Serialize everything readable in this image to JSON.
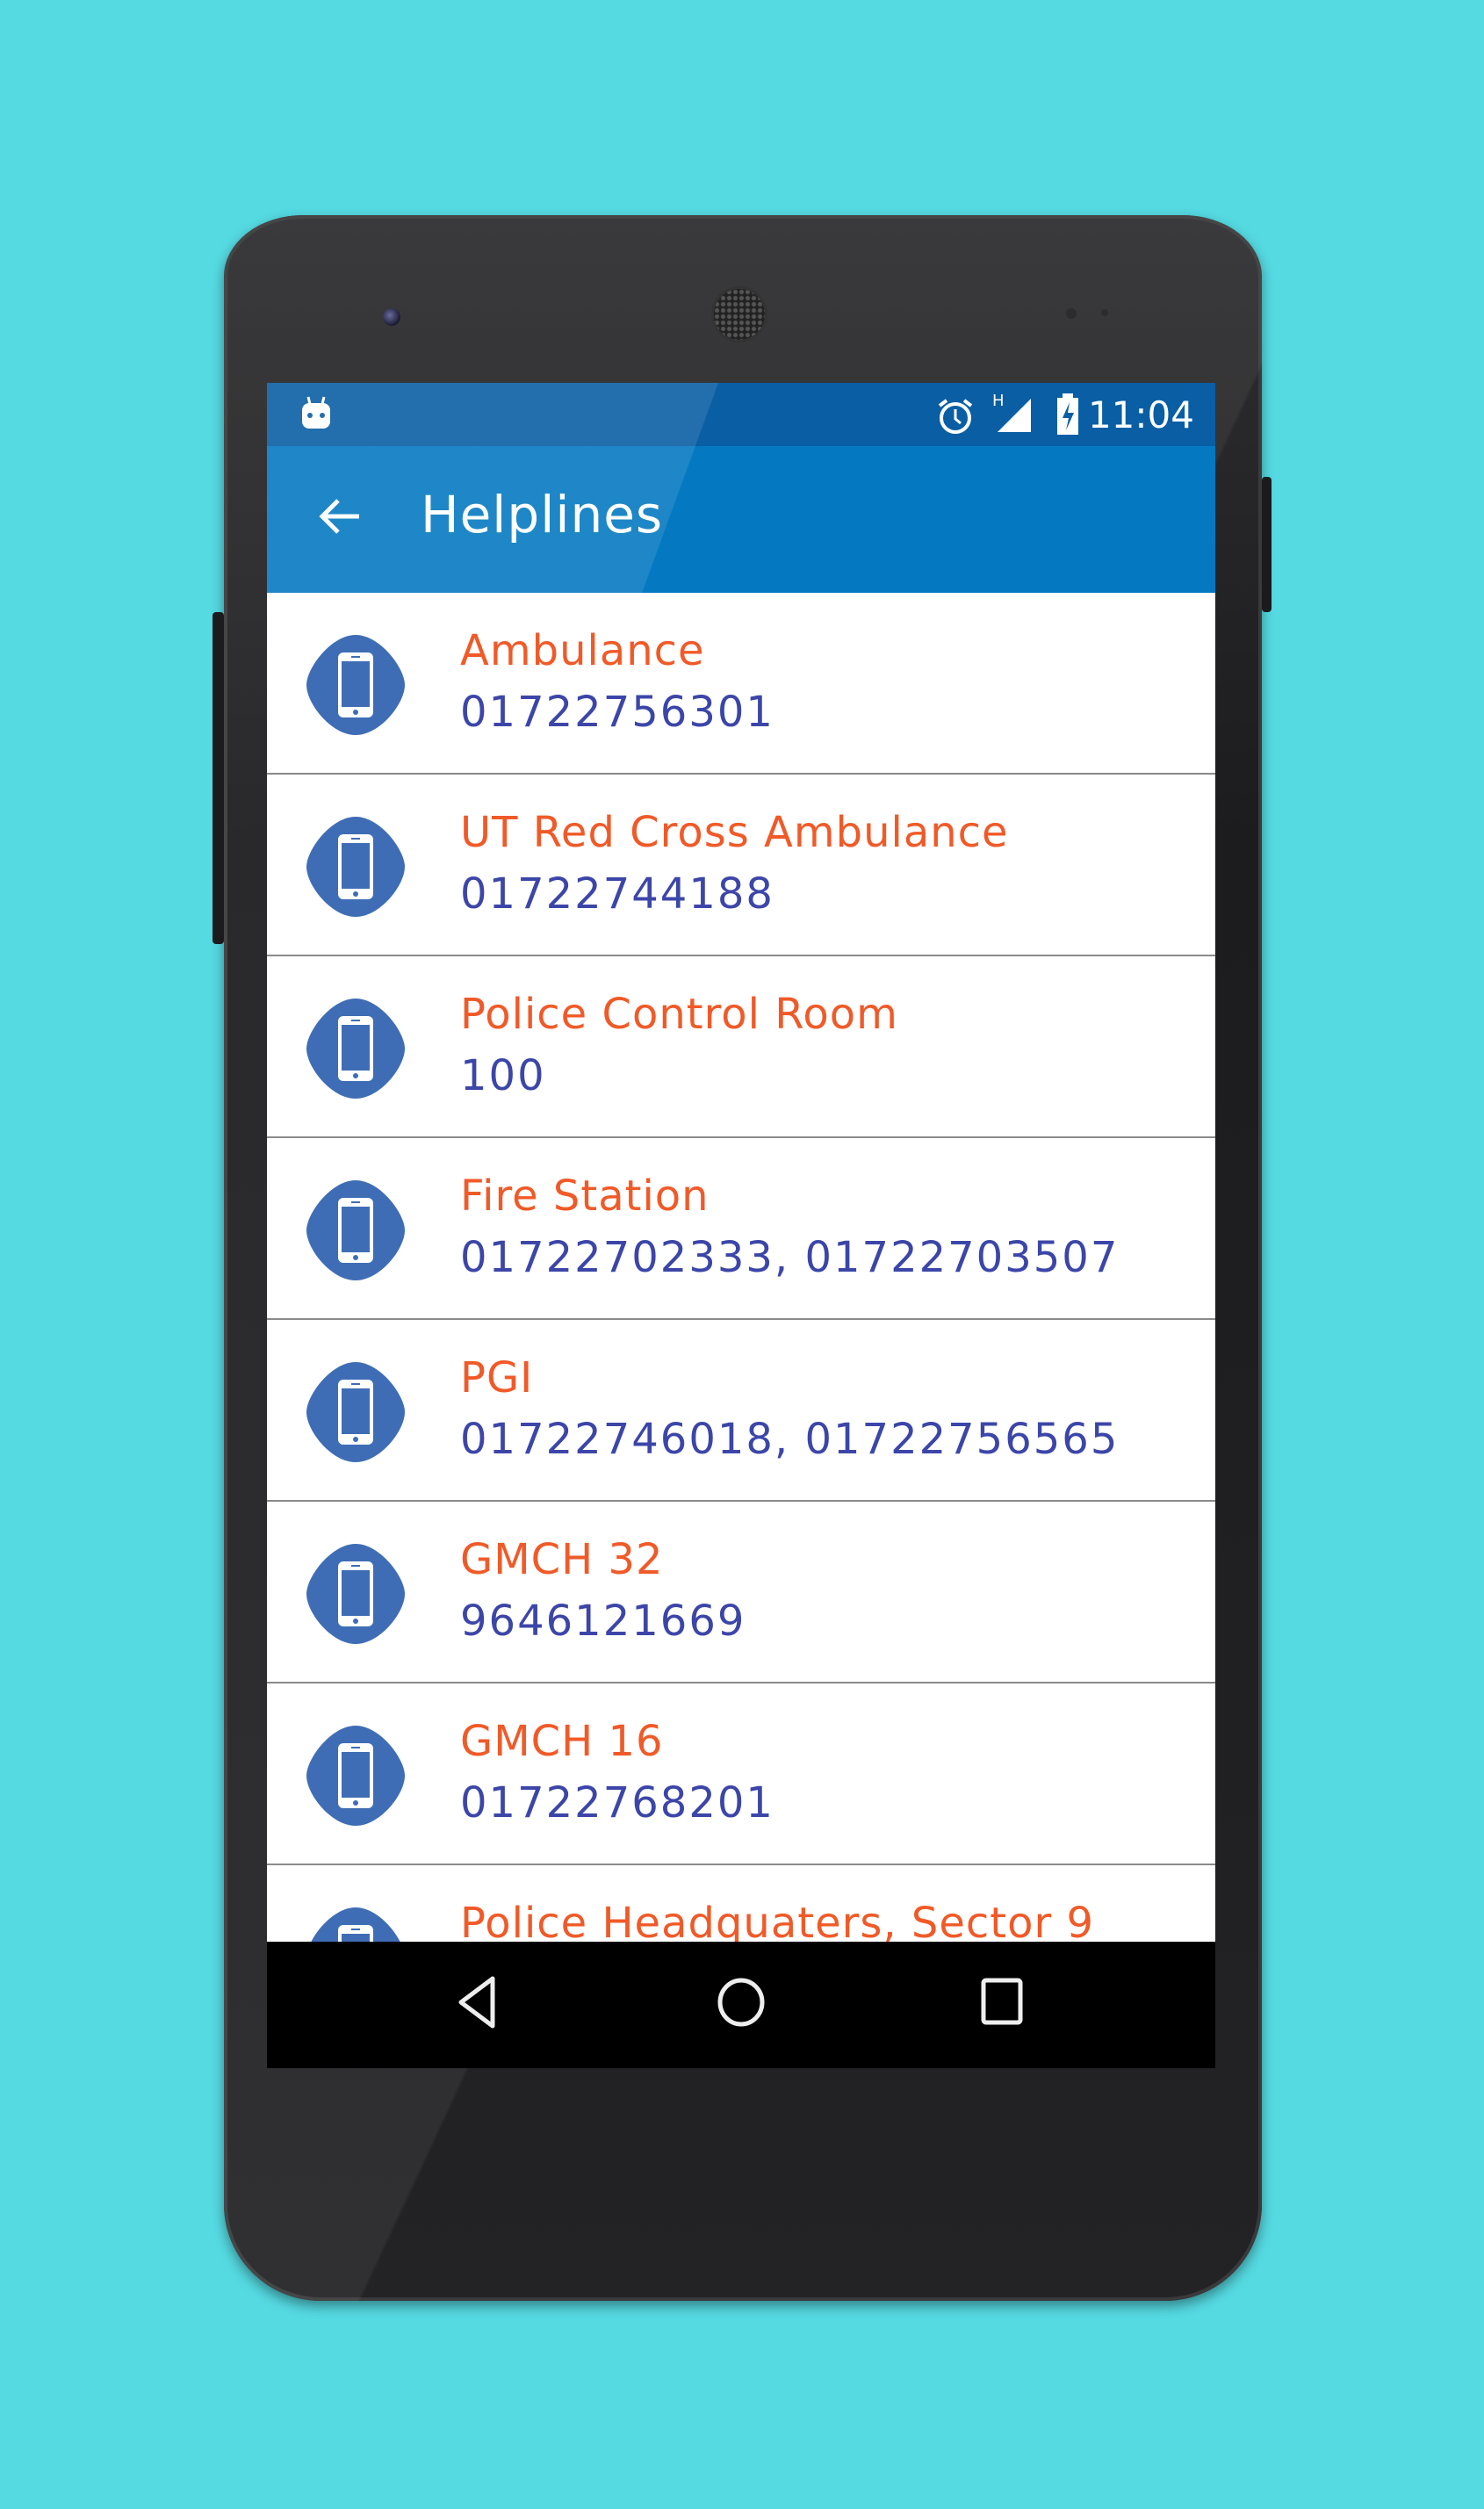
{
  "status_bar": {
    "time": "11:04",
    "network_label": "H",
    "icons": [
      "android-icon",
      "alarm-icon",
      "signal-icon",
      "battery-charging-icon"
    ]
  },
  "app_bar": {
    "title": "Helplines",
    "back_icon": "arrow-left-icon"
  },
  "colors": {
    "background": "#55dae2",
    "app_bar": "#0479c1",
    "status_bar": "#0a5ea4",
    "name": "#f05a28",
    "number": "#3c46a8",
    "icon": "#3f6db5"
  },
  "helplines": [
    {
      "name": "Ambulance",
      "number": "01722756301"
    },
    {
      "name": "UT Red Cross Ambulance",
      "number": "01722744188"
    },
    {
      "name": "Police Control Room",
      "number": "100"
    },
    {
      "name": "Fire Station",
      "number": "01722702333, 01722703507"
    },
    {
      "name": "PGI",
      "number": "01722746018, 01722756565"
    },
    {
      "name": "GMCH 32",
      "number": "9646121669"
    },
    {
      "name": "GMCH 16",
      "number": "01722768201"
    },
    {
      "name": "Police Headquaters, Sector 9",
      "number": ""
    }
  ],
  "nav_bar": {
    "icons": [
      "back-triangle-icon",
      "home-circle-icon",
      "recents-square-icon"
    ]
  }
}
